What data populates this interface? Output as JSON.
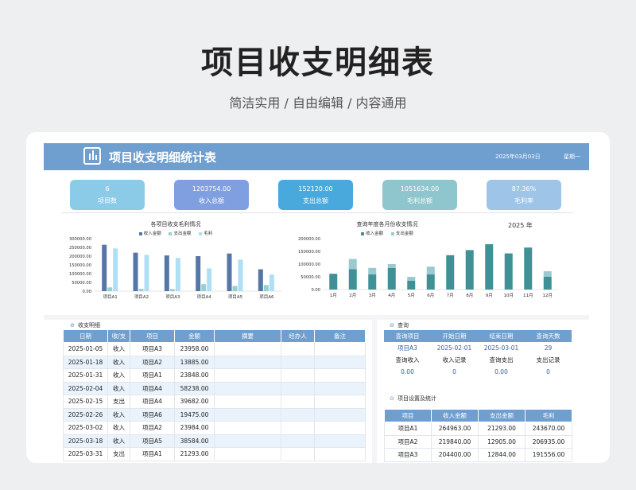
{
  "page": {
    "title": "项目收支明细表",
    "subtitle": "简洁实用 / 自由编辑 / 内容通用"
  },
  "sheet": {
    "title": "项目收支明细统计表",
    "date": "2025年03月03日",
    "weekday": "星期一"
  },
  "kpis": [
    {
      "value": "6",
      "label": "项目数",
      "color": "#8ccbe8"
    },
    {
      "value": "1203754.00",
      "label": "收入总额",
      "color": "#7f9fe0"
    },
    {
      "value": "152120.00",
      "label": "支出总额",
      "color": "#49a9dd"
    },
    {
      "value": "1051634.00",
      "label": "毛利总额",
      "color": "#8fc5cc"
    },
    {
      "value": "87.36%",
      "label": "毛利率",
      "color": "#9ec4e8"
    }
  ],
  "colors": {
    "header": "#6f9fcf",
    "income_bar": "#5677a6",
    "expense_bar": "#98cfd4",
    "profit_bar": "#aee0f5",
    "month_income": "#3f9196",
    "month_expense": "#9ac9d0"
  },
  "chart_data": [
    {
      "type": "bar",
      "title": "各项目收支毛利情况",
      "categories": [
        "项目A1",
        "项目A2",
        "项目A3",
        "项目A4",
        "项目A5",
        "项目A6"
      ],
      "series": [
        {
          "name": "收入金额",
          "values": [
            264963,
            219840,
            204000,
            200000,
            215000,
            125000
          ]
        },
        {
          "name": "支出金额",
          "values": [
            21293,
            12905,
            12000,
            40000,
            30000,
            35000
          ]
        },
        {
          "name": "毛利",
          "values": [
            243670,
            206935,
            190000,
            130000,
            180000,
            95000
          ]
        }
      ],
      "y_ticks": [
        "300000.00",
        "250000.00",
        "200000.00",
        "150000.00",
        "100000.00",
        "50000.00",
        "0.00"
      ],
      "ylim": [
        0,
        300000
      ],
      "legend": "top"
    },
    {
      "type": "bar",
      "title": "查询年度各月份收支情况",
      "year_label": "2025 年",
      "categories": [
        "1月",
        "2月",
        "3月",
        "4月",
        "5月",
        "6月",
        "7月",
        "8月",
        "9月",
        "10月",
        "11月",
        "12月"
      ],
      "series": [
        {
          "name": "收入金额",
          "values": [
            62000,
            80000,
            60000,
            85000,
            35000,
            60000,
            135000,
            155000,
            178000,
            142000,
            165000,
            50000
          ]
        },
        {
          "name": "支出金额",
          "values": [
            0,
            40000,
            25000,
            15000,
            15000,
            30000,
            0,
            0,
            0,
            0,
            0,
            22000
          ]
        }
      ],
      "y_ticks": [
        "200000.00",
        "150000.00",
        "100000.00",
        "50000.00",
        "0.00"
      ],
      "ylim": [
        0,
        200000
      ],
      "stacked": true,
      "legend": "top"
    }
  ],
  "detail": {
    "title": "收支明细",
    "columns": [
      "日期",
      "收/支",
      "项目",
      "金额",
      "摘要",
      "经办人",
      "备注"
    ],
    "rows": [
      [
        "2025-01-05",
        "收入",
        "项目A3",
        "23958.00",
        "",
        "",
        ""
      ],
      [
        "2025-01-18",
        "收入",
        "项目A2",
        "13885.00",
        "",
        "",
        ""
      ],
      [
        "2025-01-31",
        "收入",
        "项目A1",
        "23848.00",
        "",
        "",
        ""
      ],
      [
        "2025-02-04",
        "收入",
        "项目A4",
        "58238.00",
        "",
        "",
        ""
      ],
      [
        "2025-02-15",
        "支出",
        "项目A4",
        "39682.00",
        "",
        "",
        ""
      ],
      [
        "2025-02-26",
        "收入",
        "项目A6",
        "19475.00",
        "",
        "",
        ""
      ],
      [
        "2025-03-02",
        "收入",
        "项目A2",
        "23984.00",
        "",
        "",
        ""
      ],
      [
        "2025-03-18",
        "收入",
        "项目A5",
        "38584.00",
        "",
        "",
        ""
      ],
      [
        "2025-03-31",
        "支出",
        "项目A1",
        "21293.00",
        "",
        "",
        ""
      ]
    ]
  },
  "query": {
    "title": "查询",
    "head1": [
      "查询项目",
      "开始日期",
      "结束日期",
      "查询天数"
    ],
    "vals1": [
      "项目A3",
      "2025-02-01",
      "2025-03-01",
      "29"
    ],
    "head2": [
      "查询收入",
      "收入记录",
      "查询支出",
      "支出记录"
    ],
    "vals2": [
      "0.00",
      "0",
      "0.00",
      "0"
    ]
  },
  "project_stats": {
    "title": "项目设置及统计",
    "columns": [
      "项目",
      "收入金额",
      "支出金额",
      "毛利"
    ],
    "rows": [
      [
        "项目A1",
        "264963.00",
        "21293.00",
        "243670.00"
      ],
      [
        "项目A2",
        "219840.00",
        "12905.00",
        "206935.00"
      ],
      [
        "项目A3",
        "204400.00",
        "12844.00",
        "191556.00"
      ]
    ]
  }
}
